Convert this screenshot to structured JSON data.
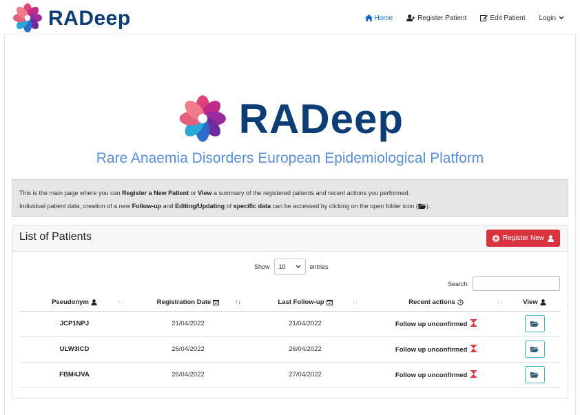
{
  "app": {
    "brand": "RADeep",
    "hero_brand": "RADeep",
    "subtitle": "Rare Anaemia Disorders European Epidemiological Platform"
  },
  "nav": {
    "home": "Home",
    "register": "Register Patient",
    "edit": "Edit Patient",
    "login": "Login"
  },
  "info": {
    "line1": {
      "a": "This is the main page where you can ",
      "b": "Register a New Patient",
      "c": " or ",
      "d": "View",
      "e": " a summary of the registered patients and recent actions you performed."
    },
    "line2": {
      "a": "Individual patient data, creation of a new ",
      "b": "Follow-up",
      "c": " and ",
      "d": "Editing/Updating",
      "e": " of ",
      "f": "specific data",
      "g": " can be accessed by clicking on the open folder icon (",
      "h": ")."
    }
  },
  "card": {
    "title": "List of Patients",
    "register_button": "Register New",
    "show_label": "Show",
    "entries_value": "10",
    "entries_label": "entries",
    "search_label": "Search:"
  },
  "table": {
    "headers": {
      "pseudonym": "Pseudonym",
      "registration_date": "Registration Date",
      "last_followup": "Last Follow-up",
      "recent_actions": "Recent actions",
      "view": "View"
    },
    "rows": [
      {
        "pseudonym": "JCP1NPJ",
        "registration_date": "21/04/2022",
        "last_followup": "21/04/2022",
        "action": "Follow up unconfirmed"
      },
      {
        "pseudonym": "ULW3ICD",
        "registration_date": "26/04/2022",
        "last_followup": "26/04/2022",
        "action": "Follow up unconfirmed"
      },
      {
        "pseudonym": "FBM4JVA",
        "registration_date": "26/04/2022",
        "last_followup": "27/04/2022",
        "action": "Follow up unconfirmed"
      }
    ]
  },
  "colors": {
    "brand_navy": "#0d3d74",
    "link_blue": "#1467c4",
    "danger": "#d9333f",
    "folder_border": "#40b6c4",
    "hourglass": "#d9333f"
  }
}
